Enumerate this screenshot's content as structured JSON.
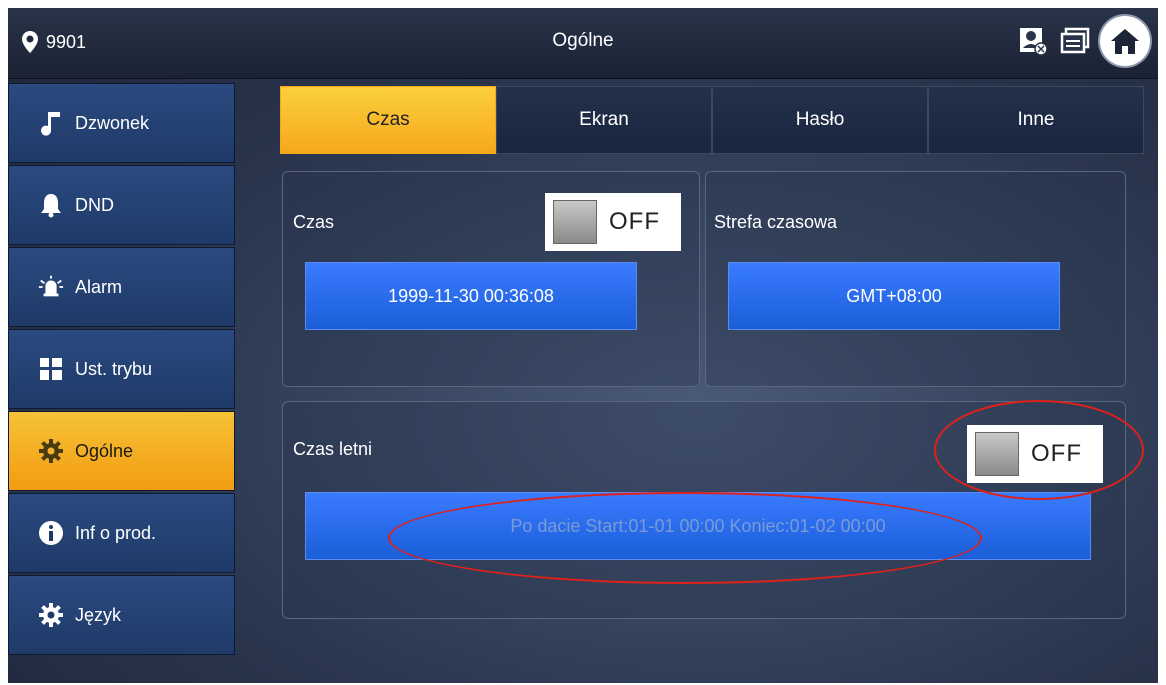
{
  "topbar": {
    "location": "9901",
    "title": "Ogólne",
    "icons": [
      "contact-card-icon",
      "message-icon",
      "home-icon"
    ]
  },
  "sidebar": {
    "items": [
      {
        "label": "Dzwonek",
        "icon": "music-note-icon",
        "active": false
      },
      {
        "label": "DND",
        "icon": "bell-icon",
        "active": false
      },
      {
        "label": "Alarm",
        "icon": "alarm-icon",
        "active": false
      },
      {
        "label": "Ust. trybu",
        "icon": "grid-icon",
        "active": false
      },
      {
        "label": "Ogólne",
        "icon": "gear-icon",
        "active": true
      },
      {
        "label": "Inf o prod.",
        "icon": "info-icon",
        "active": false
      },
      {
        "label": "Język",
        "icon": "gear-icon",
        "active": false
      }
    ]
  },
  "tabs": [
    {
      "label": "Czas",
      "active": true
    },
    {
      "label": "Ekran",
      "active": false
    },
    {
      "label": "Hasło",
      "active": false
    },
    {
      "label": "Inne",
      "active": false
    }
  ],
  "time_panel": {
    "label": "Czas",
    "toggle_state": "OFF",
    "value": "1999-11-30 00:36:08"
  },
  "timezone_panel": {
    "label": "Strefa czasowa",
    "value": "GMT+08:00"
  },
  "dst_panel": {
    "label": "Czas letni",
    "toggle_state": "OFF",
    "value": "Po dacie Start:01-01 00:00  Koniec:01-02 00:00"
  },
  "colors": {
    "accent": "#f6b22a",
    "field": "#1a5ed8",
    "annotation": "#e0201a"
  }
}
